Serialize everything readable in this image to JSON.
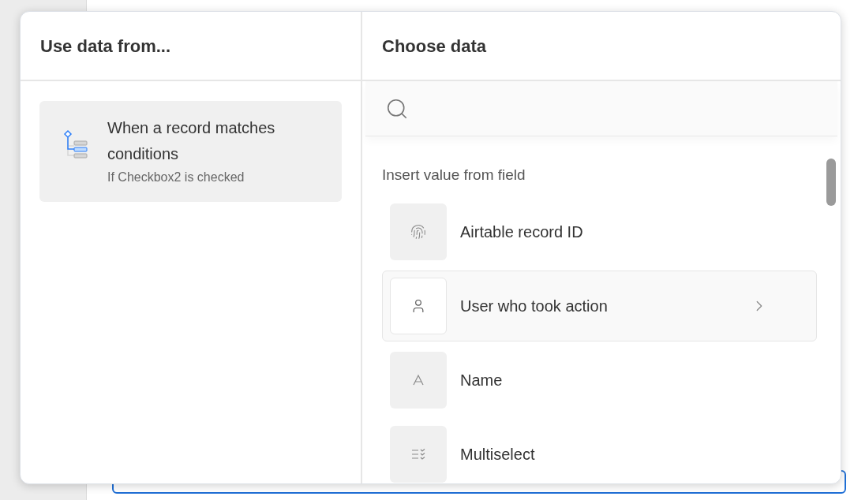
{
  "source_panel": {
    "title": "Use data from...",
    "items": [
      {
        "title": "When a record matches conditions",
        "subtitle": "If Checkbox2 is checked",
        "selected": true
      }
    ]
  },
  "data_panel": {
    "title": "Choose data",
    "section_label": "Insert value from field",
    "fields": [
      {
        "label": "Airtable record ID",
        "kind": "record_id",
        "selected": false
      },
      {
        "label": "User who took action",
        "kind": "user",
        "selected": true
      },
      {
        "label": "Name",
        "kind": "text",
        "selected": false
      },
      {
        "label": "Multiselect",
        "kind": "multiselect",
        "selected": false
      }
    ]
  }
}
